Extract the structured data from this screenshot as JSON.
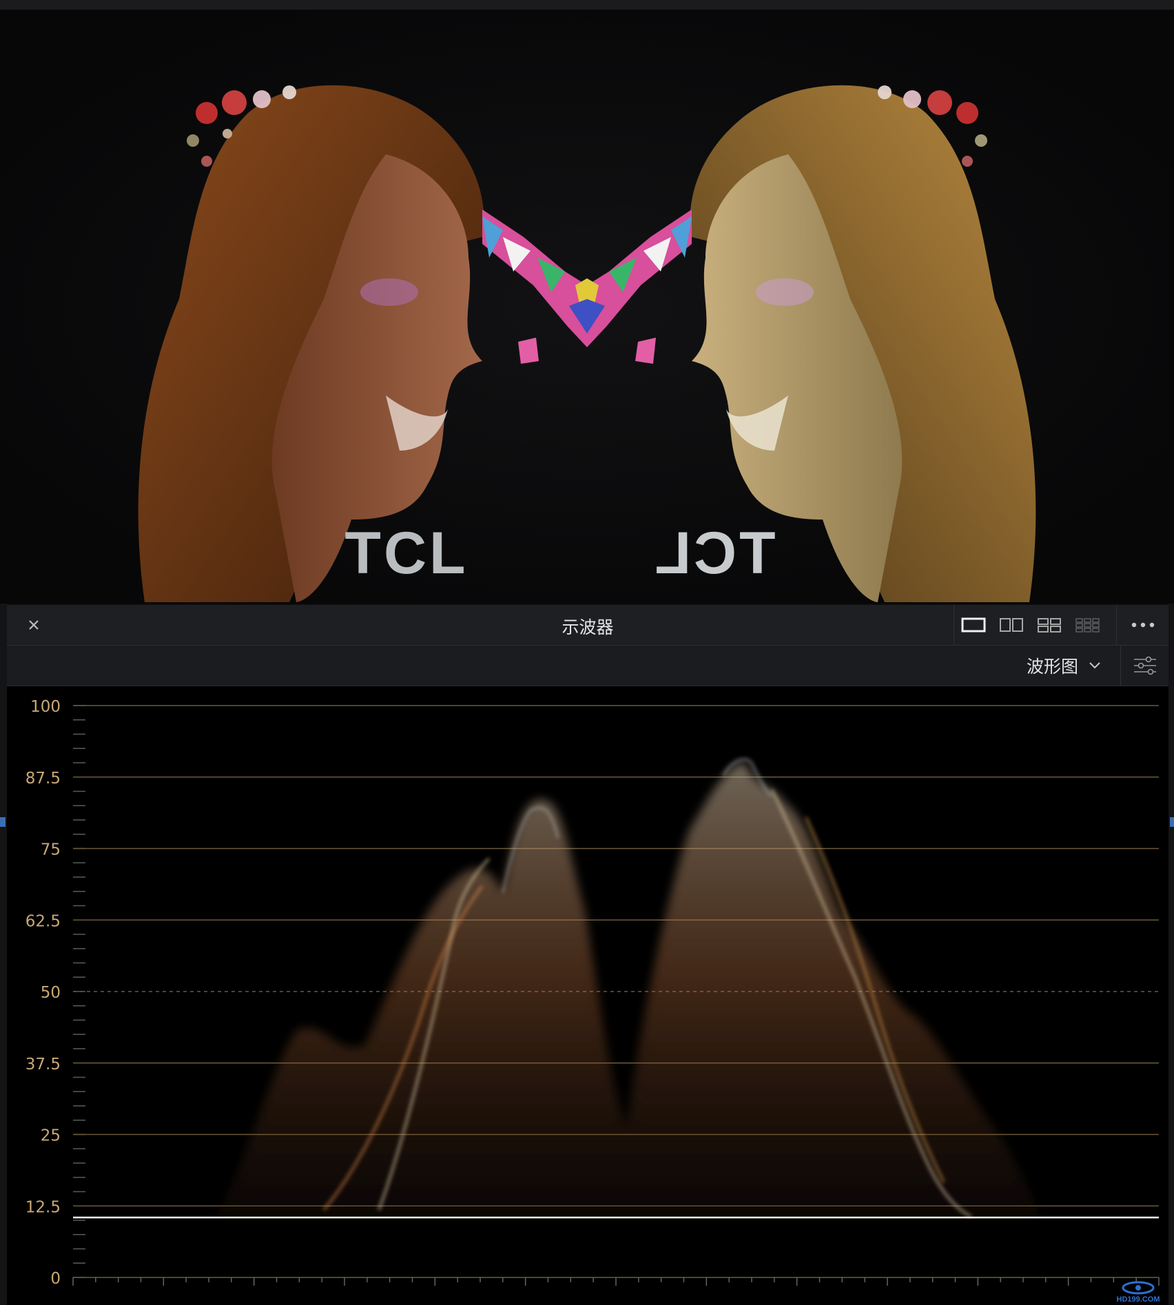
{
  "viewer": {
    "logo_left": "TCL",
    "logo_right": "TCL"
  },
  "scope_panel": {
    "title": "示波器",
    "close_label": "×",
    "layouts": [
      "single-view-icon",
      "dual-view-icon",
      "quad-view-icon",
      "grid-view-icon"
    ],
    "selected_layout": "single-view-icon",
    "more_label": "•••",
    "scope_type": "波形图"
  },
  "scale": {
    "labels": [
      "100",
      "87.5",
      "75",
      "62.5",
      "50",
      "37.5",
      "25",
      "12.5",
      "0"
    ],
    "values": [
      100,
      87.5,
      75,
      62.5,
      50,
      37.5,
      25,
      12.5,
      0
    ],
    "dashed_value": 50,
    "grid_color": "#6b5a3a",
    "label_color": "#c9a874"
  },
  "watermark": "HD199.COM"
}
